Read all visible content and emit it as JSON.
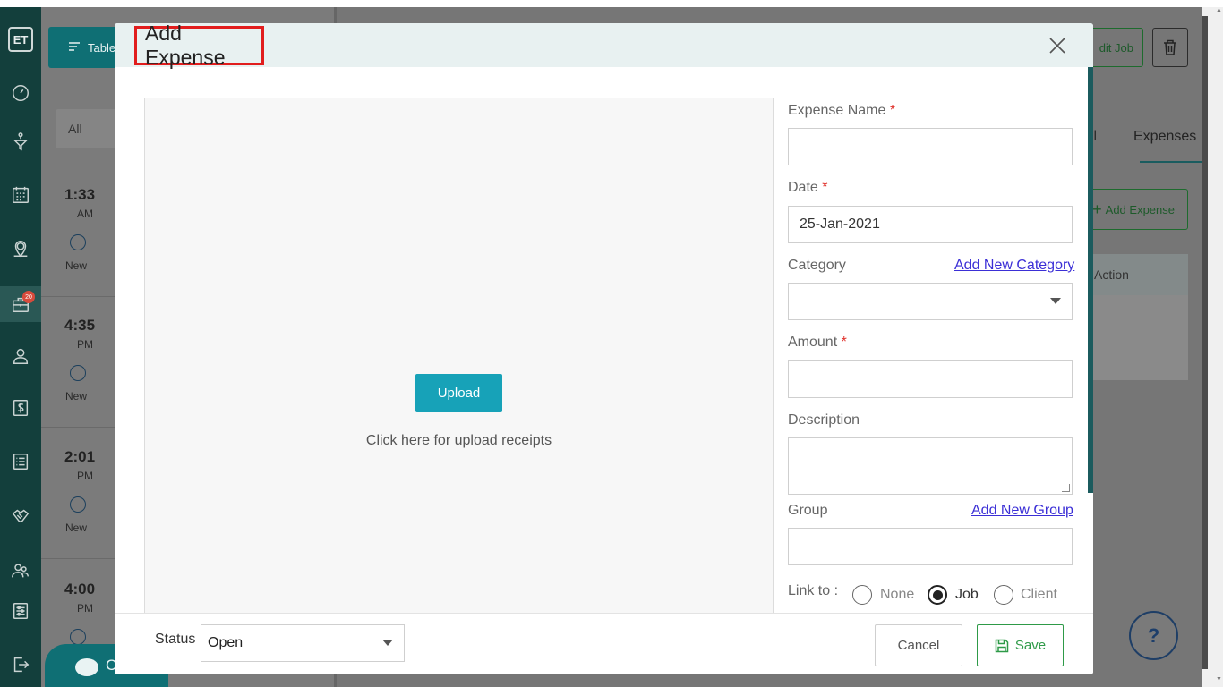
{
  "app": {
    "logo_text": "ET",
    "nav_badge_count": "20",
    "toolbar": {
      "table_label": "Table"
    },
    "filters": {
      "all_label": "All",
      "second_label_partial": "A"
    },
    "jobs": [
      {
        "time": "1:33",
        "ampm": "AM",
        "status": "New"
      },
      {
        "time": "4:35",
        "ampm": "PM",
        "status": "New"
      },
      {
        "time": "2:01",
        "ampm": "PM",
        "status": "New"
      },
      {
        "time": "4:00",
        "ampm": "PM",
        "status": ""
      }
    ],
    "right_panel": {
      "edit_job_label": "dit Job",
      "tab_detail_partial": "il",
      "tab_expenses": "Expenses",
      "add_expense_label": "Add Expense",
      "action_header": "Action",
      "help_label": "?"
    },
    "chat_partial": "C",
    "colors": {
      "sidebar": "#133f3c",
      "accent": "#17a2b8",
      "save": "#2e9a48",
      "required": "#e0302a",
      "link": "#3b2fd6"
    }
  },
  "modal": {
    "title": "Add Expense",
    "upload": {
      "button_label": "Upload",
      "hint": "Click here for upload receipts"
    },
    "form": {
      "expense_name": {
        "label": "Expense Name",
        "value": ""
      },
      "date": {
        "label": "Date",
        "value": "25-Jan-2021"
      },
      "category": {
        "label": "Category",
        "link": "Add New Category",
        "value": ""
      },
      "amount": {
        "label": "Amount",
        "value": ""
      },
      "description": {
        "label": "Description",
        "value": ""
      },
      "group": {
        "label": "Group",
        "link": "Add New Group",
        "value": ""
      },
      "link_to": {
        "label": "Link to :",
        "options": [
          "None",
          "Job",
          "Client"
        ],
        "selected": "Job"
      },
      "required_mark": "*"
    },
    "footer": {
      "status_label": "Status",
      "status_value": "Open",
      "cancel_label": "Cancel",
      "save_label": "Save"
    }
  }
}
